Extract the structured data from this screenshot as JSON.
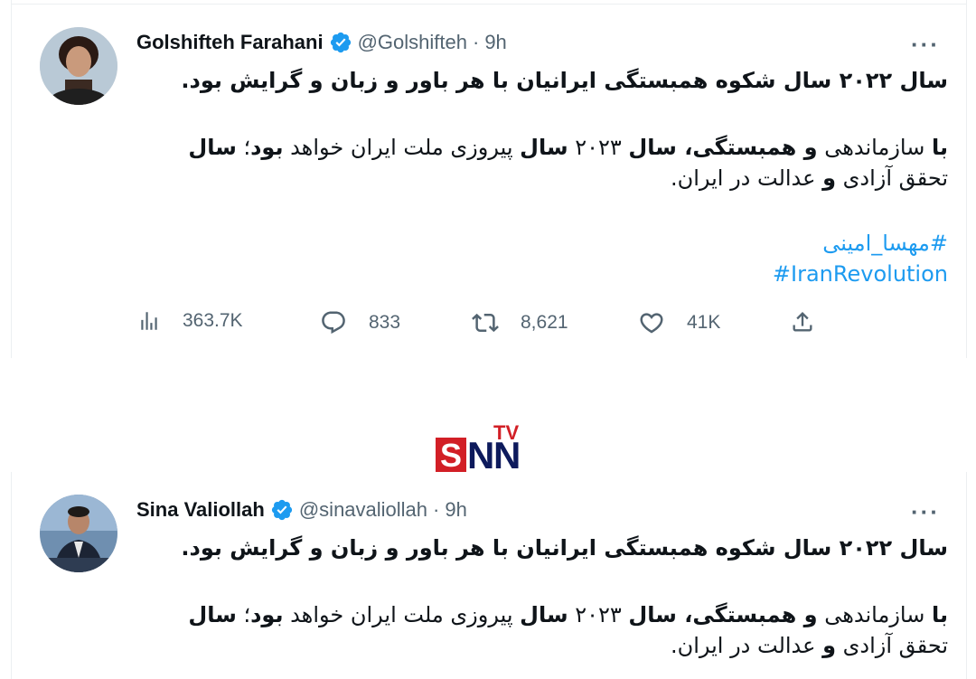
{
  "tweets": [
    {
      "name": "Golshifteh Farahani",
      "handle": "@Golshifteh",
      "separator": "·",
      "time": "9h",
      "more": "···",
      "line1": "سال ۲۰۲۲ سال شکوه همبستگی ایرانیان با هر باور و زبان و گرایش بود.",
      "p2_1": "با",
      "p2_2": " سازماندهی ",
      "p2_3": "و همبستگی، سال",
      "p2_4": " ۲۰۲۳ ",
      "p2_5": "سال",
      "p2_6": " پیروزی ملت ایران خواهد ",
      "p2_7": "بود",
      "p2_8": "؛ ",
      "p2_9": "سال",
      "p2_10": " تحقق آزادی ",
      "p2_11": "و",
      "p2_12": " عدالت در ایران.",
      "hashtag1": "#مهسا_امینی",
      "hashtag2": "#IranRevolution",
      "stats": {
        "views": "363.7K",
        "replies": "833",
        "retweets": "8,621",
        "likes": "41K"
      }
    },
    {
      "name": "Sina Valiollah",
      "handle": "@sinavaliollah",
      "separator": "·",
      "time": "9h",
      "more": "···",
      "line1": "سال ۲۰۲۲ سال شکوه همبستگی ایرانیان با هر باور و زبان و گرایش بود.",
      "p2_1": "با",
      "p2_2": " سازماندهی ",
      "p2_3": "و همبستگی، سال",
      "p2_4": " ۲۰۲۳ ",
      "p2_5": "سال",
      "p2_6": " پیروزی ملت ایران خواهد ",
      "p2_7": "بود",
      "p2_8": "؛ ",
      "p2_9": "سال",
      "p2_10": " تحقق آزادی ",
      "p2_11": "و",
      "p2_12": " عدالت در ایران."
    }
  ],
  "watermark": {
    "letters_main": "SNN",
    "letters_small": "TV",
    "colors": {
      "red": "#d21f26",
      "navy": "#0d1a5c"
    }
  },
  "colors": {
    "link": "#1d9bf0",
    "muted": "#536471",
    "text": "#0f1419"
  }
}
